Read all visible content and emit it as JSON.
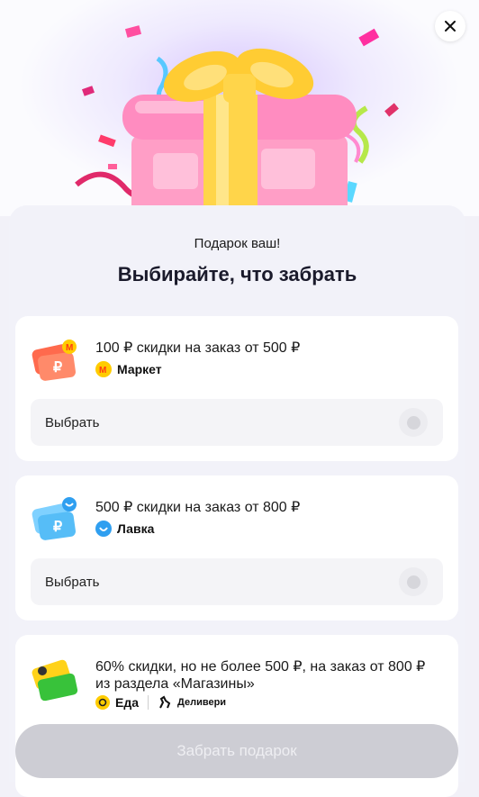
{
  "header": {
    "close_icon": "close-icon"
  },
  "dialog": {
    "subtitle": "Подарок ваш!",
    "title": "Выбирайте, что забрать"
  },
  "offers": [
    {
      "text": "100 ₽ скидки на заказ от 500 ₽",
      "brand": "Маркет",
      "icon": "market-coupon-icon",
      "choose_label": "Выбрать"
    },
    {
      "text": "500 ₽ скидки на заказ от 800 ₽",
      "brand": "Лавка",
      "icon": "lavka-coupon-icon",
      "choose_label": "Выбрать"
    },
    {
      "text": "60% скидки, но не более 500 ₽,  на заказ от 800 ₽ из раздела «Магазины»",
      "brand": "Еда",
      "brand2": "Деливери",
      "icon": "eda-coupon-icon"
    }
  ],
  "footer": {
    "claim_label": "Забрать подарок"
  },
  "colors": {
    "market": "#ff5226",
    "lavka": "#36a9f5",
    "eda": "#ffcc00",
    "gift_ribbon": "#ffd54a",
    "gift_box": "#ff9ec6"
  }
}
